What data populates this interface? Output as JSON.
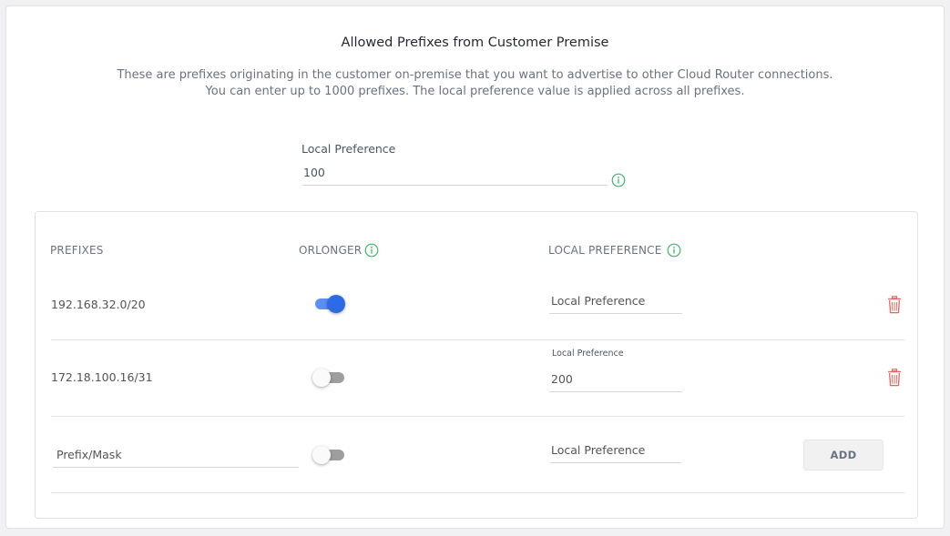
{
  "header": {
    "title": "Allowed Prefixes from Customer Premise",
    "description_line1": "These are prefixes originating in the customer on-premise that you want to advertise to other Cloud Router connections.",
    "description_line2": "You can enter up to 1000 prefixes. The local preference value is applied across all prefixes."
  },
  "global_local_preference": {
    "label": "Local Preference",
    "value": "100",
    "info_icon": "info-icon"
  },
  "table": {
    "columns": {
      "prefixes": "PREFIXES",
      "orlonger": "ORLONGER",
      "local_preference": "LOCAL PREFERENCE"
    },
    "rows": [
      {
        "prefix": "192.168.32.0/20",
        "orlonger": true,
        "local_preference_value": "",
        "local_preference_placeholder": "Local Preference",
        "delete_icon": "trash-icon"
      },
      {
        "prefix": "172.18.100.16/31",
        "orlonger": false,
        "local_preference_label": "Local Preference",
        "local_preference_value": "200",
        "delete_icon": "trash-icon"
      }
    ],
    "new_row": {
      "prefix_placeholder": "Prefix/Mask",
      "orlonger": false,
      "local_preference_placeholder": "Local Preference",
      "add_label": "ADD"
    }
  },
  "colors": {
    "accent_blue": "#2c6be6",
    "info_green": "#3fb76a",
    "delete_red": "#e06a63"
  }
}
